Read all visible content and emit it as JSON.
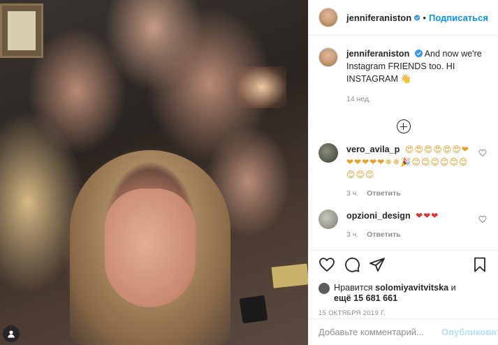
{
  "post": {
    "user_tag_icon": "user-icon"
  },
  "header": {
    "username": "jenniferaniston",
    "dot": "•",
    "follow_label": "Подписаться"
  },
  "caption": {
    "username": "jenniferaniston",
    "text": "And now we're Instagram FRIENDS too. HI INSTAGRAM 👋",
    "time": "14 нед."
  },
  "comments": [
    {
      "username": "vero_avila_p",
      "text": "😍😍😍😍😍😍❤❤❤❤❤❤✵✵🎉😊😊😊😊😊😊😊😊😊",
      "time": "3 ч.",
      "reply": "Ответить"
    },
    {
      "username": "opzioni_design",
      "text": "❤❤❤",
      "time": "3 ч.",
      "reply": "Ответить"
    }
  ],
  "likes": {
    "prefix": "Нравится",
    "user": "solomiyavitvitska",
    "and": "и",
    "more": "ещё 15 681 661"
  },
  "date": "15 ОКТЯБРЯ 2019 Г.",
  "add_comment": {
    "placeholder": "Добавьте комментарий...",
    "publish_label": "Опубликовать"
  },
  "colors": {
    "accent": "#0095f6",
    "verified": "#3897f0",
    "muted": "#8e8e8e",
    "publish_disabled": "#b2dffc"
  }
}
